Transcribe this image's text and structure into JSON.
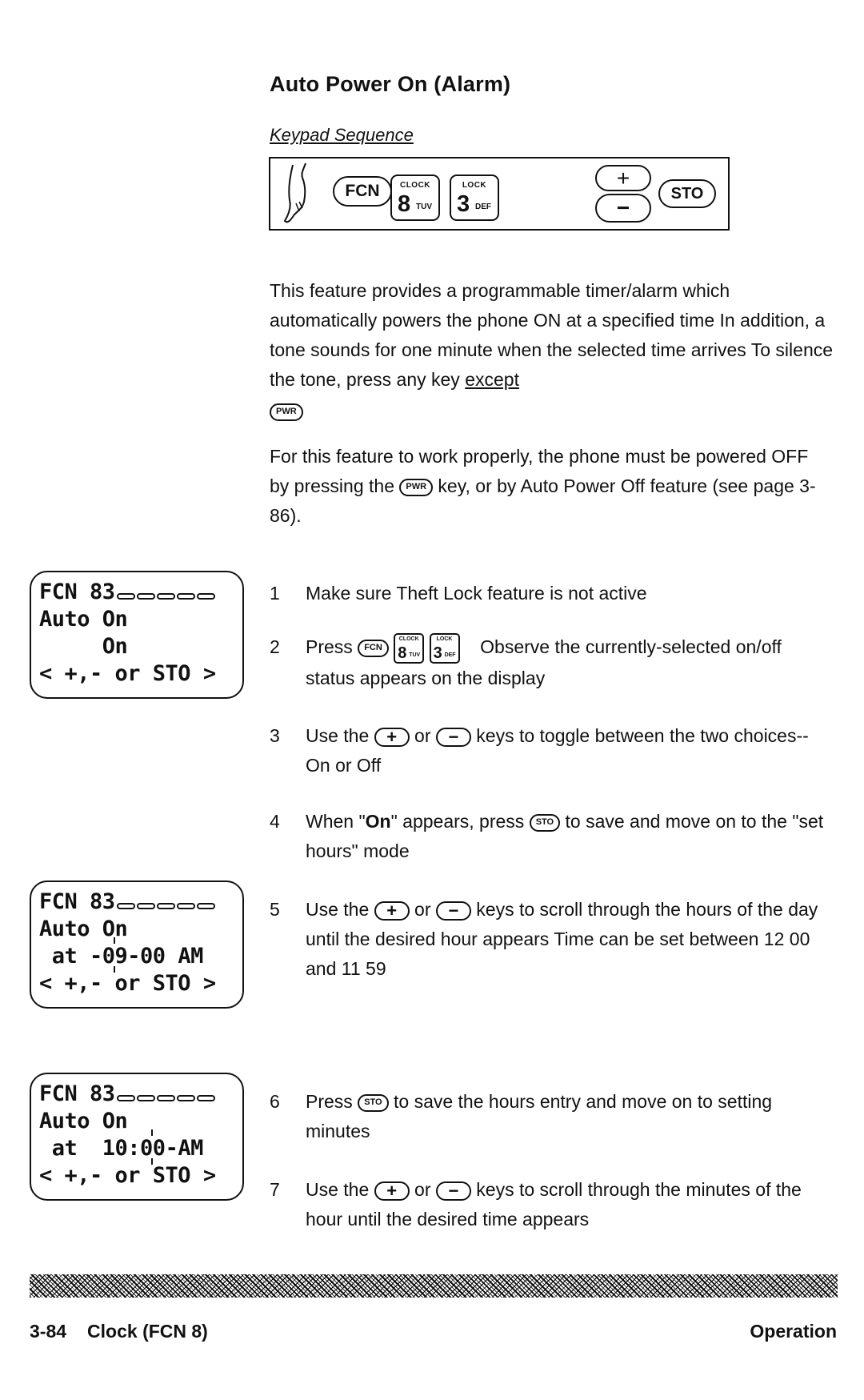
{
  "section": {
    "title": "Auto Power On (Alarm)",
    "keypad_label": "Keypad Sequence"
  },
  "keypad_sequence": {
    "icon": "finger-press-icon",
    "fcn": "FCN",
    "key8": {
      "top": "CLOCK",
      "num": "8",
      "sub": "TUV"
    },
    "key3": {
      "top": "LOCK",
      "num": "3",
      "sub": "DEF"
    },
    "plus": "+",
    "minus": "−",
    "sto": "STO"
  },
  "intro": {
    "p1_text": "This feature provides a programmable timer/alarm which automatically powers the phone ON at a specified time In addition, a tone sounds for one minute when the selected time arrives To silence the tone, press any key ",
    "p1_emph": "except",
    "p1_key": "PWR",
    "p2_before": "For this feature to work properly, the phone must be powered OFF by pressing the ",
    "p2_key": "PWR",
    "p2_after": " key, or by Auto Power Off feature (see page 3-86)."
  },
  "steps": [
    {
      "num": "1",
      "text": "Make sure Theft Lock feature is not active"
    },
    {
      "num": "2",
      "before": "Press ",
      "after": " Observe the currently-selected on/off status appears on the display"
    },
    {
      "num": "3",
      "before": "Use the ",
      "mid": " or ",
      "after": " keys to toggle between the two choices--On or Off"
    },
    {
      "num": "4",
      "before": "When \"",
      "bold": "On",
      "mid": "\" appears, press ",
      "after": " to save and move on to the \"set hours\" mode"
    },
    {
      "num": "5",
      "before": "Use the ",
      "mid": " or ",
      "after": " keys to scroll through the hours of the day until the desired hour appears Time can be set between 12 00 and 11 59"
    },
    {
      "num": "6",
      "before": "Press ",
      "after": " to save the hours entry and move on to setting minutes"
    },
    {
      "num": "7",
      "before": "Use the ",
      "mid": " or ",
      "after": " keys to scroll through the minutes of the hour until the desired time appears"
    }
  ],
  "displays": [
    {
      "line1": "FCN 83",
      "line2": "Auto On",
      "line3": "     On",
      "line4": "< +,- or STO >"
    },
    {
      "line1": "FCN 83",
      "line2": "Auto On",
      "line3_pre": " at -",
      "line3_blink": "09",
      "line3_post": "-00 AM",
      "line4": "< +,- or STO >"
    },
    {
      "line1": "FCN 83",
      "line2": "Auto On",
      "line3_pre": " at  10:",
      "line3_blink": "00",
      "line3_post": "-AM",
      "line4": "< +,- or STO >"
    }
  ],
  "footer": {
    "page": "3-84",
    "chapter": "Clock (FCN 8)",
    "section": "Operation"
  }
}
